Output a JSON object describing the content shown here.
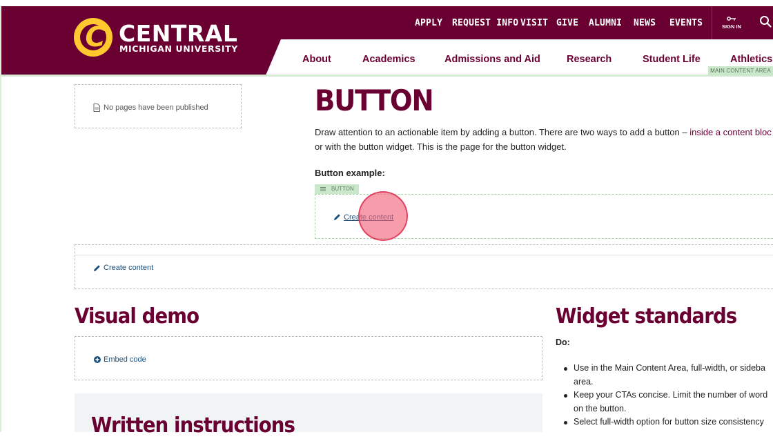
{
  "brand": {
    "name": "CENTRAL",
    "subtitle": "MICHIGAN UNIVERSITY",
    "colors": {
      "maroon": "#6a0032",
      "gold": "#ffc82e"
    }
  },
  "utility_nav": {
    "items": [
      "APPLY",
      "REQUEST INFO",
      "VISIT",
      "GIVE",
      "ALUMNI",
      "NEWS",
      "EVENTS"
    ],
    "sign_in": "SIGN IN",
    "icons": {
      "sign_in": "key-icon",
      "search": "search-icon"
    }
  },
  "main_nav": {
    "items": [
      "About",
      "Academics",
      "Admissions and Aid",
      "Research",
      "Student Life",
      "Athletics"
    ]
  },
  "editor": {
    "main_content_area_label": "MAIN CONTENT AREA",
    "button_widget_label": "BUTTON",
    "create_content": "Create content",
    "embed_code": "Embed code"
  },
  "sidebar": {
    "empty_text": "No pages have been published"
  },
  "content": {
    "title": "BUTTON",
    "intro_part1": "Draw attention to an actionable item by adding a button. There are two ways to add a button – ",
    "intro_link": "inside a content bloc",
    "intro_line2": "or with the button widget. This is the page for the button widget.",
    "button_example_label": "Button example:"
  },
  "visual_demo": {
    "title": "Visual demo"
  },
  "written_instructions": {
    "title": "Written instructions"
  },
  "widget_standards": {
    "title": "Widget standards",
    "do_label": "Do:",
    "items": [
      "Use in the Main Content Area, full-width, or sideba",
      "area.",
      "Keep your CTAs concise. Limit the number of word",
      "on the button.",
      "Select full-width option for button size consistency"
    ]
  }
}
